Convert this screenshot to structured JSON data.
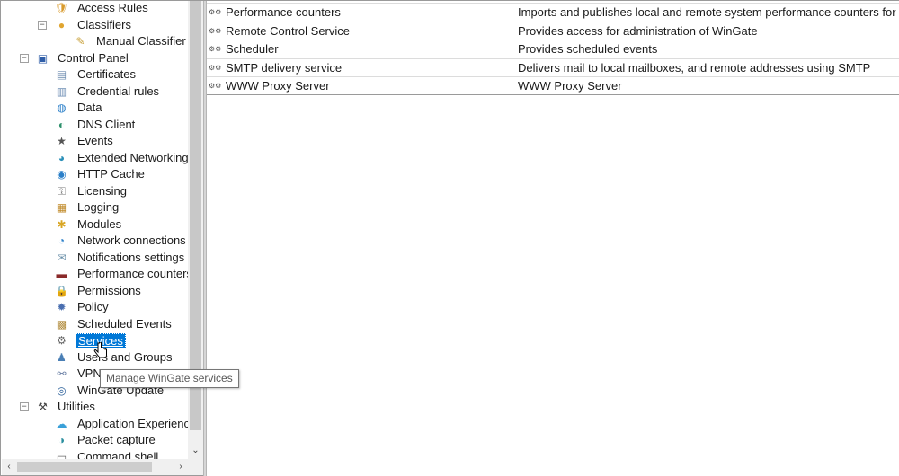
{
  "tree": {
    "items": [
      {
        "key": "access_rules",
        "label": "Access Rules",
        "level": 2,
        "icon": "shield-icon",
        "icon_glyph": "🛡",
        "expander": ""
      },
      {
        "key": "classifiers",
        "label": "Classifiers",
        "level": 2,
        "icon": "classifier-icon",
        "icon_glyph": "●",
        "expander": "−"
      },
      {
        "key": "manual_classifier",
        "label": "Manual Classifier",
        "level": 3,
        "icon": "pencil-icon",
        "icon_glyph": "✎",
        "expander": ""
      },
      {
        "key": "control_panel",
        "label": "Control Panel",
        "level": 1,
        "icon": "control-panel-icon",
        "icon_glyph": "▣",
        "expander": "−"
      },
      {
        "key": "certificates",
        "label": "Certificates",
        "level": 2,
        "icon": "certificate-icon",
        "icon_glyph": "▤",
        "expander": ""
      },
      {
        "key": "credential_rules",
        "label": "Credential rules",
        "level": 2,
        "icon": "credential-icon",
        "icon_glyph": "▥",
        "expander": ""
      },
      {
        "key": "data",
        "label": "Data",
        "level": 2,
        "icon": "globe-icon",
        "icon_glyph": "◍",
        "expander": ""
      },
      {
        "key": "dns_client",
        "label": "DNS Client",
        "level": 2,
        "icon": "dns-icon",
        "icon_glyph": "◐",
        "expander": ""
      },
      {
        "key": "events",
        "label": "Events",
        "level": 2,
        "icon": "star-icon",
        "icon_glyph": "★",
        "expander": ""
      },
      {
        "key": "extended_networking",
        "label": "Extended Networking",
        "level": 2,
        "icon": "network-globe-icon",
        "icon_glyph": "◕",
        "expander": ""
      },
      {
        "key": "http_cache",
        "label": "HTTP Cache",
        "level": 2,
        "icon": "cache-globe-icon",
        "icon_glyph": "◉",
        "expander": ""
      },
      {
        "key": "licensing",
        "label": "Licensing",
        "level": 2,
        "icon": "key-icon",
        "icon_glyph": "⚿",
        "expander": ""
      },
      {
        "key": "logging",
        "label": "Logging",
        "level": 2,
        "icon": "log-icon",
        "icon_glyph": "▦",
        "expander": ""
      },
      {
        "key": "modules",
        "label": "Modules",
        "level": 2,
        "icon": "puzzle-icon",
        "icon_glyph": "✱",
        "expander": ""
      },
      {
        "key": "network_connections",
        "label": "Network connections",
        "level": 2,
        "icon": "network-icon",
        "icon_glyph": "◔",
        "expander": ""
      },
      {
        "key": "notifications_settings",
        "label": "Notifications settings",
        "level": 2,
        "icon": "bell-icon",
        "icon_glyph": "✉",
        "expander": ""
      },
      {
        "key": "performance_counters",
        "label": "Performance counters",
        "level": 2,
        "icon": "performance-icon",
        "icon_glyph": "▬",
        "expander": ""
      },
      {
        "key": "permissions",
        "label": "Permissions",
        "level": 2,
        "icon": "lock-icon",
        "icon_glyph": "🔒",
        "expander": ""
      },
      {
        "key": "policy",
        "label": "Policy",
        "level": 2,
        "icon": "policy-gear-icon",
        "icon_glyph": "✹",
        "expander": ""
      },
      {
        "key": "scheduled_events",
        "label": "Scheduled Events",
        "level": 2,
        "icon": "calendar-icon",
        "icon_glyph": "▩",
        "expander": ""
      },
      {
        "key": "services",
        "label": "Services",
        "level": 2,
        "icon": "gears-icon",
        "icon_glyph": "⚙",
        "expander": "",
        "selected": true
      },
      {
        "key": "users_and_groups",
        "label": "Users and Groups",
        "level": 2,
        "icon": "users-icon",
        "icon_glyph": "♟",
        "expander": ""
      },
      {
        "key": "vpn",
        "label": "VPN",
        "level": 2,
        "icon": "vpn-icon",
        "icon_glyph": "⚯",
        "expander": ""
      },
      {
        "key": "wingate_update",
        "label": "WinGate Update",
        "level": 2,
        "icon": "update-icon",
        "icon_glyph": "◎",
        "expander": ""
      },
      {
        "key": "utilities",
        "label": "Utilities",
        "level": 1,
        "icon": "tools-icon",
        "icon_glyph": "⚒",
        "expander": "−"
      },
      {
        "key": "application_experience",
        "label": "Application Experience",
        "level": 2,
        "icon": "cloud-icon",
        "icon_glyph": "☁",
        "expander": ""
      },
      {
        "key": "packet_capture",
        "label": "Packet capture",
        "level": 2,
        "icon": "capture-globe-icon",
        "icon_glyph": "◑",
        "expander": ""
      },
      {
        "key": "command_shell",
        "label": "Command shell",
        "level": 2,
        "icon": "shell-icon",
        "icon_glyph": "▭",
        "expander": ""
      }
    ],
    "selected": "services"
  },
  "services": {
    "rows": [
      {
        "name": "Performance counters",
        "description": "Imports and publishes local and remote system performance counters for"
      },
      {
        "name": "Remote Control Service",
        "description": "Provides access for administration of WinGate"
      },
      {
        "name": "Scheduler",
        "description": "Provides scheduled events"
      },
      {
        "name": "SMTP delivery service",
        "description": "Delivers mail to local mailboxes, and remote addresses using SMTP"
      },
      {
        "name": "WWW Proxy Server",
        "description": "WWW Proxy Server"
      }
    ],
    "row_icon": "service-gear-icon"
  },
  "tooltip": {
    "text": "Manage WinGate services"
  },
  "colors": {
    "selection": "#0078d7",
    "splitter": "#d6d6d6",
    "scrollbar_track": "#f0f0f0",
    "scrollbar_thumb": "#c8c8c8"
  }
}
